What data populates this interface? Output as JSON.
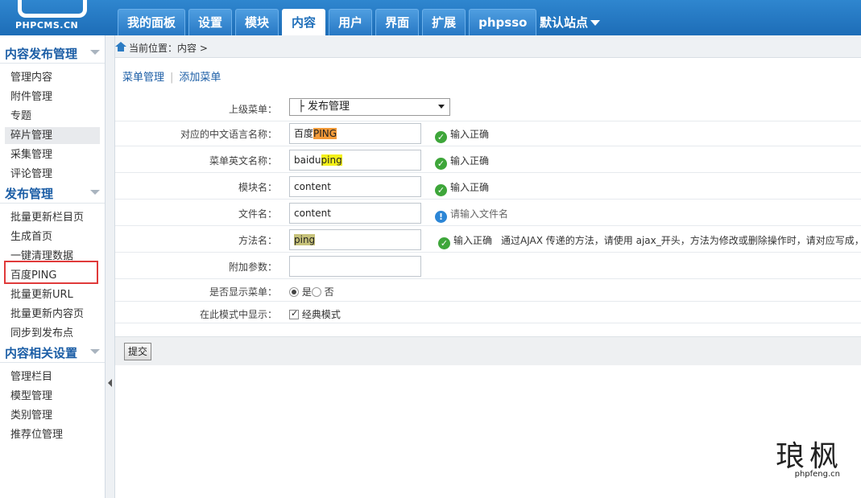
{
  "logo": {
    "text": "PHPCMS.CN"
  },
  "tabs": [
    {
      "label": "我的面板",
      "active": false
    },
    {
      "label": "设置",
      "active": false
    },
    {
      "label": "模块",
      "active": false
    },
    {
      "label": "内容",
      "active": true
    },
    {
      "label": "用户",
      "active": false
    },
    {
      "label": "界面",
      "active": false
    },
    {
      "label": "扩展",
      "active": false
    },
    {
      "label": "phpsso",
      "active": false
    }
  ],
  "site_select": {
    "label": "默认站点"
  },
  "sidebar": {
    "sections": [
      {
        "title": "内容发布管理",
        "items": [
          "管理内容",
          "附件管理",
          "专题",
          "碎片管理",
          "采集管理",
          "评论管理"
        ]
      },
      {
        "title": "发布管理",
        "items": [
          "批量更新栏目页",
          "生成首页",
          "一键清理数据",
          "百度PING",
          "批量更新URL",
          "批量更新内容页",
          "同步到发布点"
        ]
      },
      {
        "title": "内容相关设置",
        "items": [
          "管理栏目",
          "模型管理",
          "类别管理",
          "推荐位管理"
        ]
      }
    ]
  },
  "breadcrumb": {
    "text": "当前位置：内容 >"
  },
  "subnav": {
    "menu_manage": "菜单管理",
    "separator": "|",
    "add_menu": "添加菜单"
  },
  "form": {
    "parent_menu": {
      "label": "上级菜单：",
      "value": "├ 发布管理"
    },
    "cn_name": {
      "label": "对应的中文语言名称：",
      "value_plain": "百度",
      "value_hl": "PING",
      "tip": "输入正确"
    },
    "en_name": {
      "label": "菜单英文名称：",
      "value_plain": "baidu",
      "value_hl": "ping",
      "tip": "输入正确"
    },
    "module": {
      "label": "模块名：",
      "value": "content",
      "tip": "输入正确"
    },
    "file": {
      "label": "文件名：",
      "value": "content",
      "tip": "请输入文件名"
    },
    "method": {
      "label": "方法名：",
      "value": "ping",
      "tip": "输入正确",
      "note": "通过AJAX 传递的方法，请使用 ajax_开头，方法为修改或删除操作时，请对应写成，"
    },
    "params": {
      "label": "附加参数：",
      "value": ""
    },
    "display": {
      "label": "是否显示菜单：",
      "yes": "是",
      "no": "否"
    },
    "mode": {
      "label": "在此模式中显示：",
      "option": "经典模式"
    }
  },
  "submit": {
    "label": "提交"
  },
  "watermark": {
    "big": "琅枫",
    "small": "phpfeng.cn"
  }
}
